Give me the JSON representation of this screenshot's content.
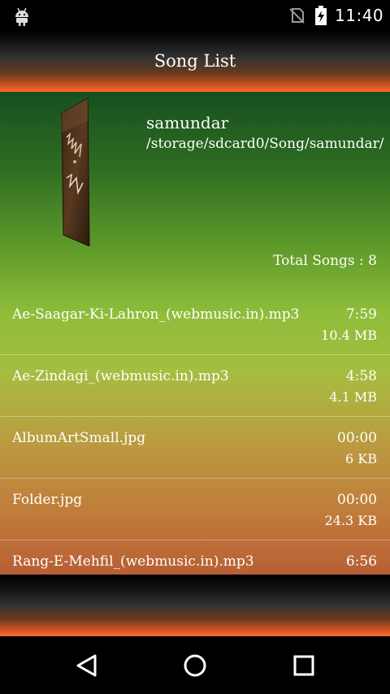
{
  "status_bar": {
    "time": "11:40",
    "icons": [
      "android-icon",
      "no-sim-icon",
      "battery-charging-icon"
    ]
  },
  "title_bar": {
    "title": "Song List"
  },
  "folder": {
    "name": "samundar",
    "path": "/storage/sdcard0/Song/samundar/",
    "total_songs_label": "Total Songs : 8"
  },
  "songs": [
    {
      "name": "Ae-Saagar-Ki-Lahron_(webmusic.in).mp3",
      "duration": "7:59",
      "size": "10.4 MB"
    },
    {
      "name": "Ae-Zindagi_(webmusic.in).mp3",
      "duration": "4:58",
      "size": "4.1 MB"
    },
    {
      "name": "AlbumArtSmall.jpg",
      "duration": "00:00",
      "size": "6 KB"
    },
    {
      "name": "Folder.jpg",
      "duration": "00:00",
      "size": "24.3 KB"
    },
    {
      "name": "Rang-E-Mehfil_(webmusic.in).mp3",
      "duration": "6:56",
      "size": ""
    }
  ],
  "nav_bar": {
    "icons": [
      "back-icon",
      "home-icon",
      "recents-icon"
    ]
  }
}
